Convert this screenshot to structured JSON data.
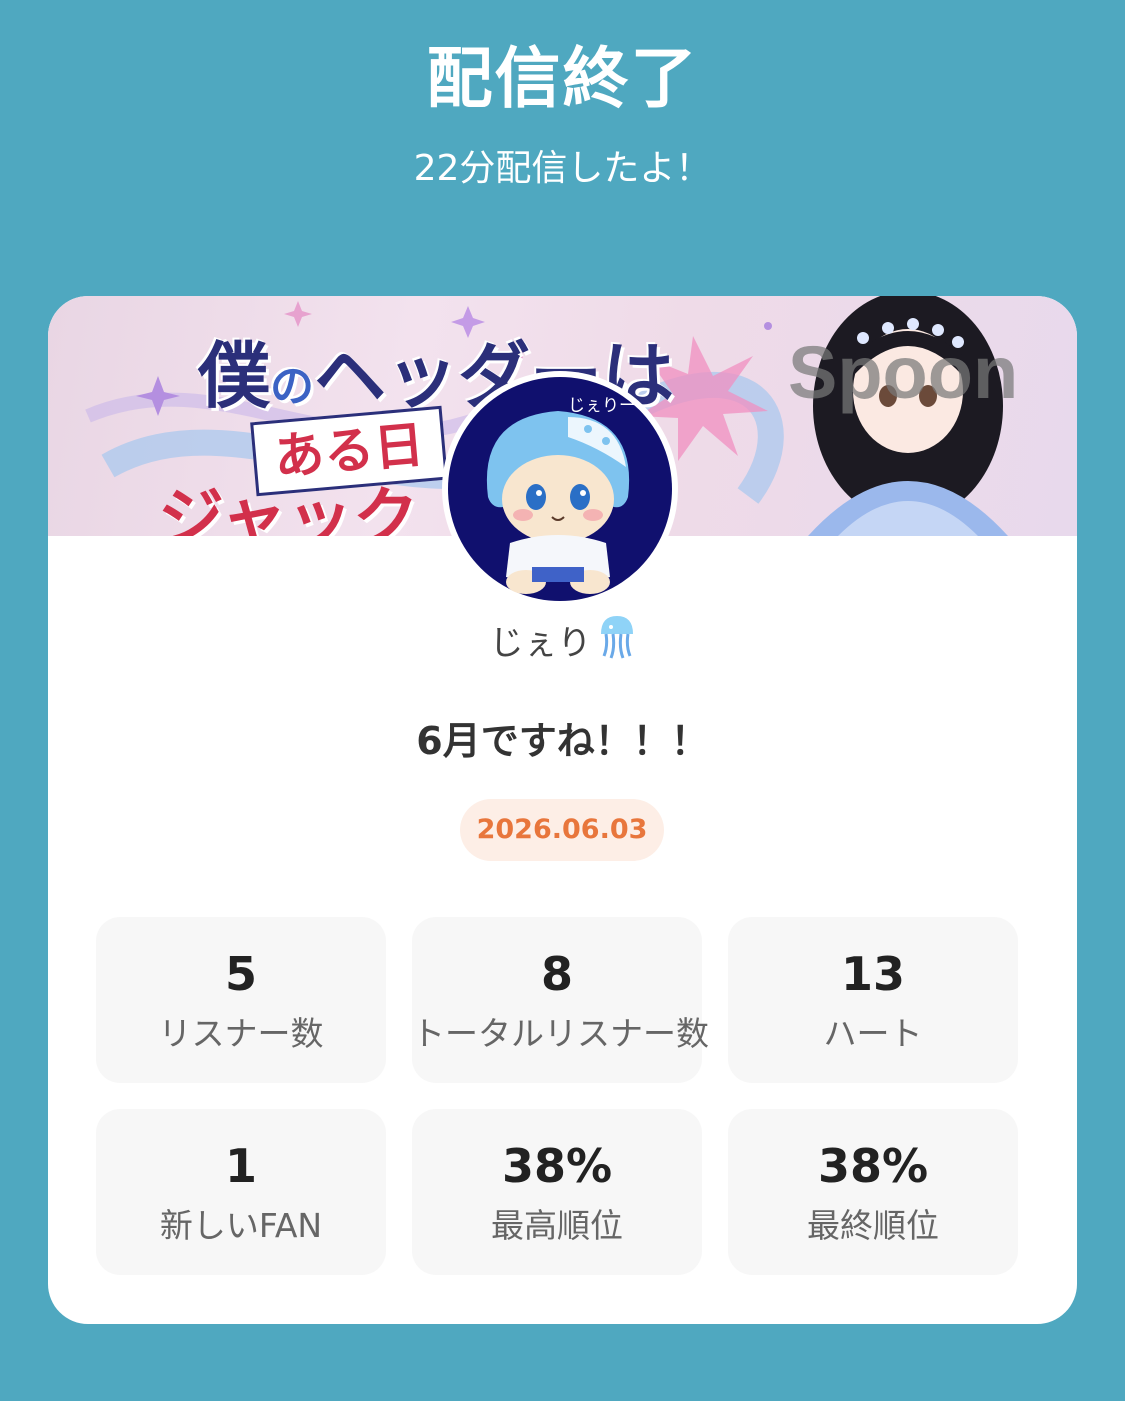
{
  "header": {
    "title": "配信終了",
    "subtitle": "22分配信したよ！"
  },
  "banner": {
    "line1_big": "僕",
    "line1_small": "の",
    "line1_rest": "ヘッダーは",
    "line2": "ある日",
    "line3": "ジャック",
    "watermark": "Spoon",
    "colors": {
      "background": "#efdbe8",
      "accent_red": "#d2304b",
      "accent_navy": "#2b2f7a"
    }
  },
  "profile": {
    "avatar_icon": "jellyfish-plush-avatar",
    "avatar_caption": "じぇりー",
    "name": "じぇり",
    "name_icon": "jellyfish-icon"
  },
  "broadcast": {
    "message": "6月ですね！！！",
    "date": "2026.06.03"
  },
  "stats": [
    {
      "value": "5",
      "label": "リスナー数"
    },
    {
      "value": "8",
      "label": "トータルリスナー数"
    },
    {
      "value": "13",
      "label": "ハート"
    },
    {
      "value": "1",
      "label": "新しいFAN"
    },
    {
      "value": "38%",
      "label": "最高順位"
    },
    {
      "value": "38%",
      "label": "最終順位"
    }
  ],
  "colors": {
    "page_background": "#4fa8c0",
    "card_background": "#ffffff",
    "date_badge_background": "#fdeee6",
    "date_text": "#e8763c",
    "stat_tile_background": "#f7f7f7"
  }
}
